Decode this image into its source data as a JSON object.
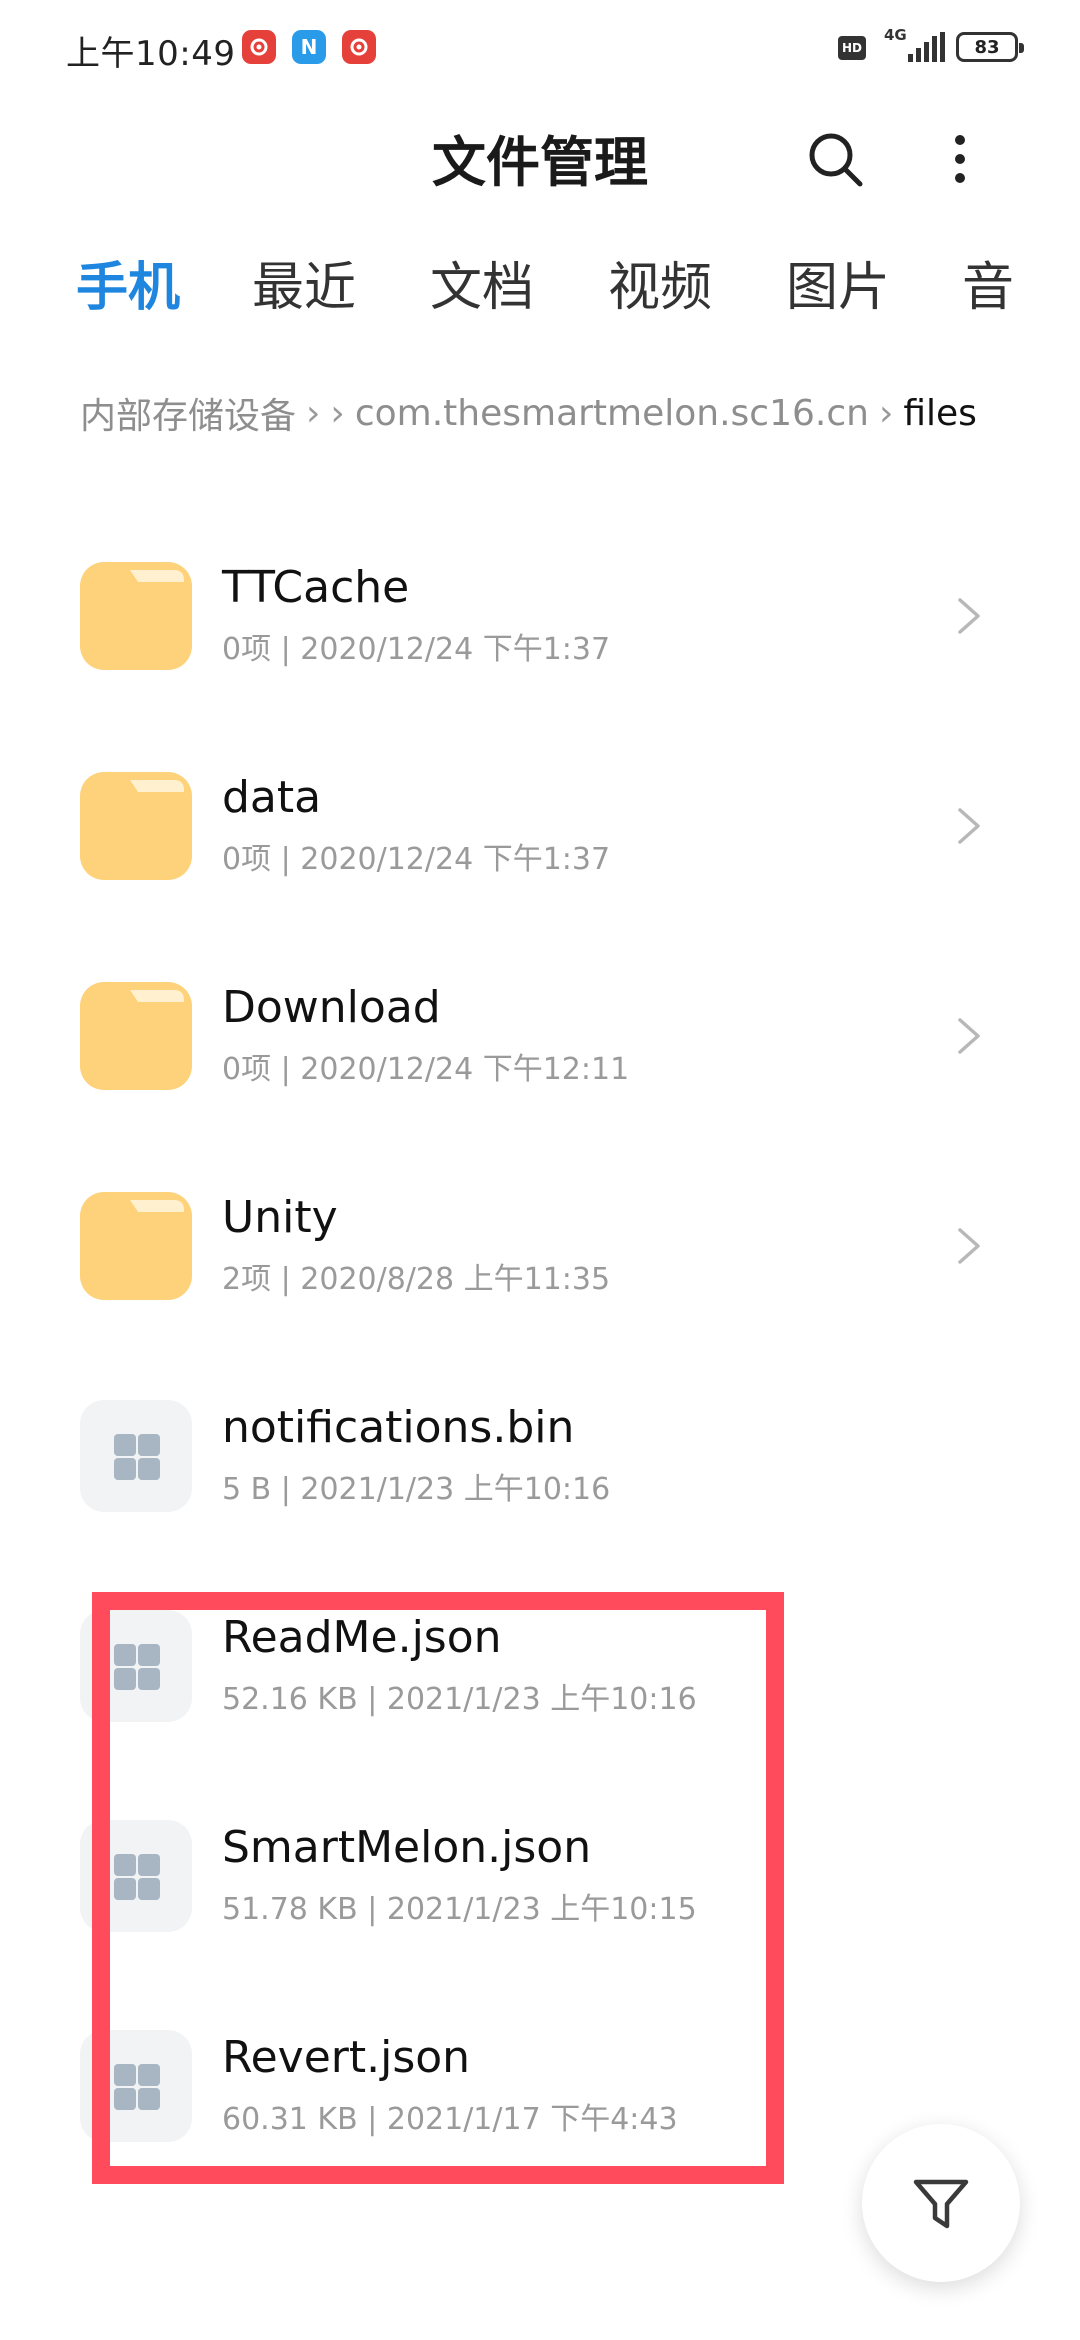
{
  "status_bar": {
    "time": "上午10:49",
    "notification_icons": [
      "netease-music-icon",
      "n-app-icon",
      "netease-music-icon"
    ],
    "hd_label": "HD",
    "network_label": "4G",
    "battery_level": "83"
  },
  "header": {
    "title": "文件管理",
    "search_icon": "search-icon",
    "more_icon": "more-vertical-icon"
  },
  "tabs": [
    {
      "label": "手机",
      "active": true
    },
    {
      "label": "最近",
      "active": false
    },
    {
      "label": "文档",
      "active": false
    },
    {
      "label": "视频",
      "active": false
    },
    {
      "label": "图片",
      "active": false
    },
    {
      "label": "音",
      "active": false
    }
  ],
  "breadcrumb": {
    "root": "内部存储设备",
    "middle": "com.thesmartmelon.sc16.cn",
    "current": "files"
  },
  "files": [
    {
      "name": "TTCache",
      "meta": "0项  |  2020/12/24 下午1:37",
      "type": "folder"
    },
    {
      "name": "data",
      "meta": "0项  |  2020/12/24 下午1:37",
      "type": "folder"
    },
    {
      "name": "Download",
      "meta": "0项  |  2020/12/24 下午12:11",
      "type": "folder"
    },
    {
      "name": "Unity",
      "meta": "2项  |  2020/8/28 上午11:35",
      "type": "folder"
    },
    {
      "name": "notifications.bin",
      "meta": "5 B  |  2021/1/23 上午10:16",
      "type": "file"
    },
    {
      "name": "ReadMe.json",
      "meta": "52.16 KB  |  2021/1/23 上午10:16",
      "type": "file"
    },
    {
      "name": "SmartMelon.json",
      "meta": "51.78 KB  |  2021/1/23 上午10:15",
      "type": "file"
    },
    {
      "name": "Revert.json",
      "meta": "60.31 KB  |  2021/1/17 下午4:43",
      "type": "file"
    }
  ],
  "colors": {
    "accent": "#1f86e0",
    "folder": "#fdd27a",
    "highlight": "#ff4b5c"
  },
  "fab_icon": "filter-icon"
}
